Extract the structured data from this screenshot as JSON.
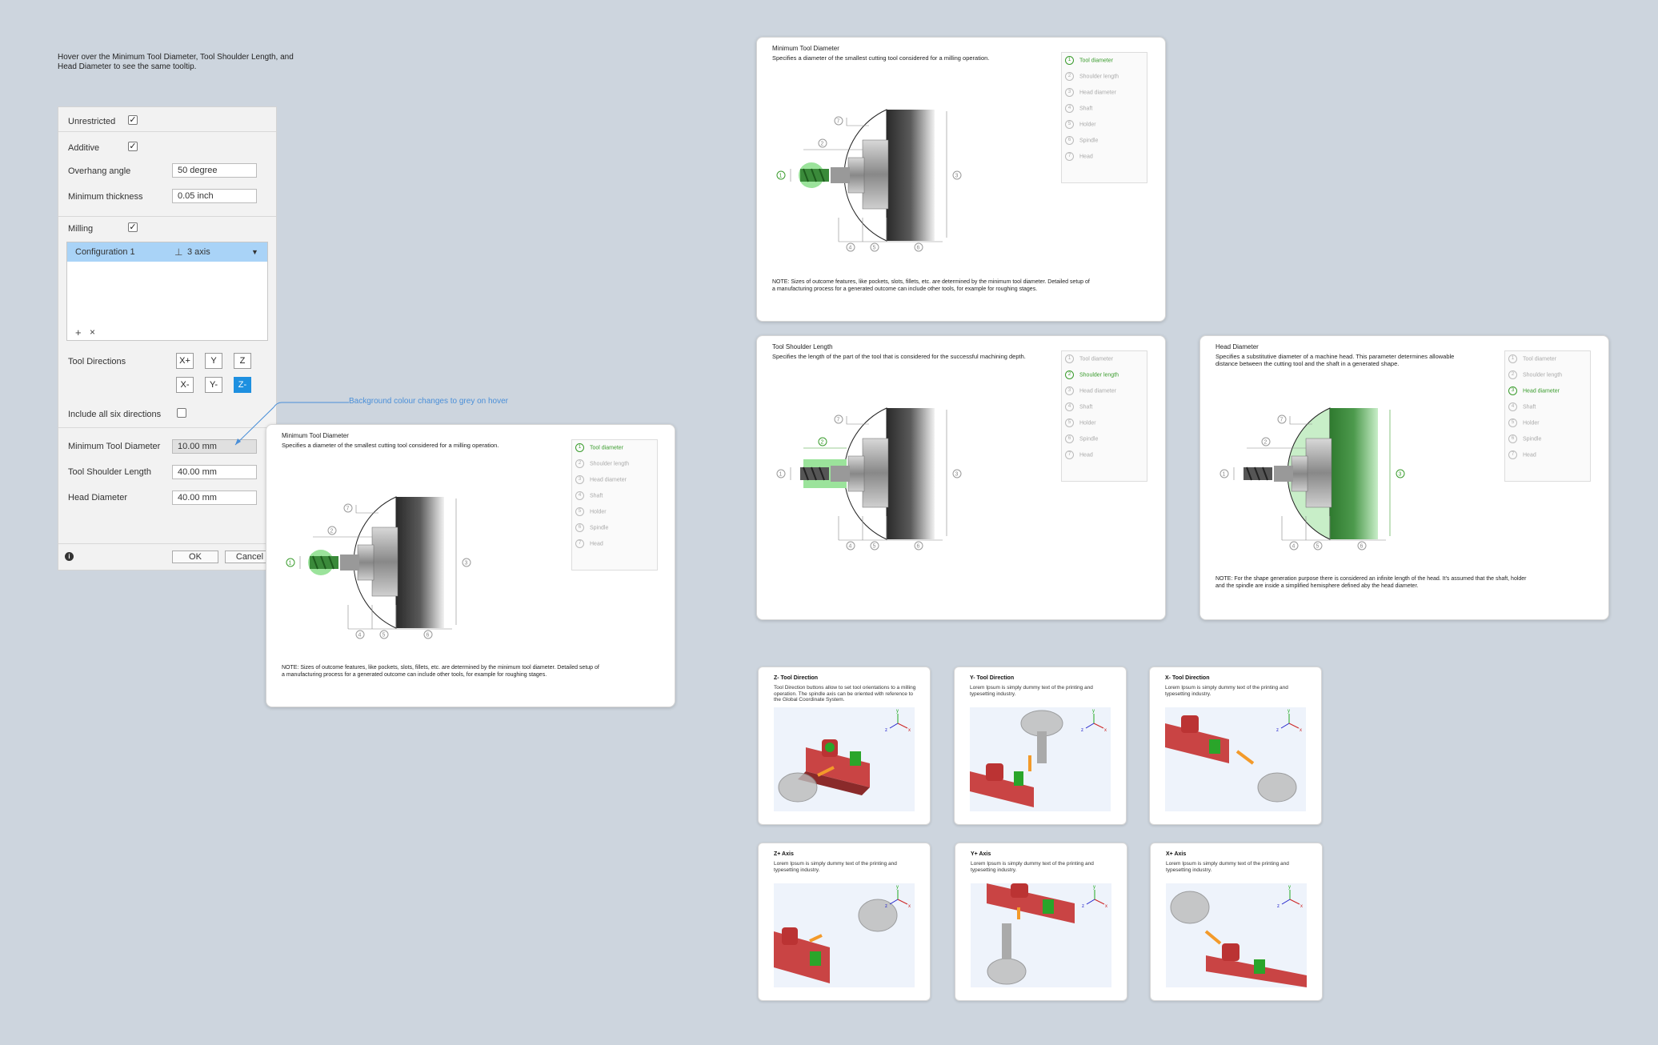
{
  "intro_text": "Hover over the Minimum Tool Diameter, Tool Shoulder Length, and Head Diameter to see the same tooltip.",
  "panel": {
    "unrestricted_label": "Unrestricted",
    "additive_label": "Additive",
    "overhang_label": "Overhang angle",
    "overhang_value": "50 degree",
    "min_thickness_label": "Minimum thickness",
    "min_thickness_value": "0.05 inch",
    "milling_label": "Milling",
    "config_name": "Configuration 1",
    "config_axis": "3 axis",
    "add_symbol": "+",
    "remove_symbol": "×",
    "tool_directions_label": "Tool Directions",
    "dir_xplus": "X+",
    "dir_y": "Y",
    "dir_z": "Z",
    "dir_xminus": "X-",
    "dir_yminus": "Y-",
    "dir_zminus": "Z-",
    "include_all_label": "Include all six directions",
    "min_tool_diam_label": "Minimum Tool Diameter",
    "min_tool_diam_value": "10.00 mm",
    "shoulder_label": "Tool Shoulder Length",
    "shoulder_value": "40.00 mm",
    "head_label": "Head Diameter",
    "head_value": "40.00 mm",
    "ok_label": "OK",
    "cancel_label": "Cancel",
    "info_icon": "info-icon"
  },
  "annotation": "Background colour changes to grey on hover",
  "legend_items": [
    "Tool diameter",
    "Shoulder length",
    "Head diameter",
    "Shaft",
    "Holder",
    "Spindle",
    "Head"
  ],
  "cards": {
    "min_tool": {
      "title": "Minimum Tool Diameter",
      "desc": "Specifies a diameter of the smallest cutting tool considered for a milling operation.",
      "note": "NOTE: Sizes of outcome features, like pockets, slots, fillets, etc. are determined by the minimum tool diameter. Detailed setup of a manufacturing process for a generated outcome can include other tools, for example for roughing stages."
    },
    "shoulder": {
      "title": "Tool Shoulder Length",
      "desc": "Specifies the length of the part of the tool that is considered for the successful machining depth."
    },
    "head": {
      "title": "Head Diameter",
      "desc": "Specifies a substitutive diameter of a machine head. This parameter determines allowable distance between the cutting tool and the shaft in a generated shape.",
      "note": "NOTE: For the shape generation purpose there is considered an infinite length of the head. It's assumed that the shaft, holder and the spindle are inside a simplified hemisphere defined aby the head diameter."
    }
  },
  "small_cards": [
    {
      "title": "Z- Tool Direction",
      "desc": "Tool Direction buttons allow to set tool orientations to a milling operation. The spindle axis can be oriented with reference to the Global Coordinate System."
    },
    {
      "title": "Y- Tool Direction",
      "desc": "Lorem Ipsum is simply dummy text of the printing and typesetting industry."
    },
    {
      "title": "X- Tool Direction",
      "desc": "Lorem Ipsum is simply dummy text of the printing and typesetting industry."
    },
    {
      "title": "Z+ Axis",
      "desc": "Lorem Ipsum is simply dummy text of the printing and typesetting industry."
    },
    {
      "title": "Y+ Axis",
      "desc": "Lorem Ipsum is simply dummy text of the printing and typesetting industry."
    },
    {
      "title": "X+ Axis",
      "desc": "Lorem Ipsum is simply dummy text of the printing and typesetting industry."
    }
  ],
  "axis_labels": {
    "x": "x",
    "y": "y",
    "z": "z"
  },
  "colors": {
    "accent_green": "#3a9c2d",
    "highlight_green": "#9be39b",
    "selection_blue": "#a9d3f7",
    "active_button": "#1e90e0"
  }
}
